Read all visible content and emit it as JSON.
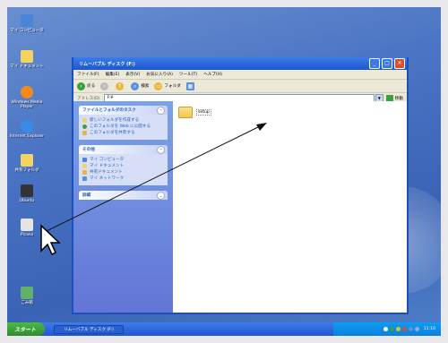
{
  "desktop_icons": [
    {
      "label": "マイ コンピュータ",
      "color": "#4a86d8"
    },
    {
      "label": "マイ ドキュメント",
      "color": "#f3d363"
    },
    {
      "label": "Windows Media Player",
      "color": "#f28a1d"
    },
    {
      "label": "Internet Explorer",
      "color": "#3c8ae8"
    },
    {
      "label": "共有フォルダ",
      "color": "#f3d363"
    },
    {
      "label": "Ubuntu",
      "color": "#333333"
    },
    {
      "label": "Picasa",
      "color": "#e5e5e5"
    },
    {
      "label": "ごみ箱",
      "color": "#5fb06a"
    }
  ],
  "window": {
    "title": "リムーバブル ディスク (F:)",
    "menu": [
      "ファイル(F)",
      "編集(E)",
      "表示(V)",
      "お気に入り(A)",
      "ツール(T)",
      "ヘルプ(H)"
    ],
    "toolbar": {
      "back": "戻る",
      "search": "検索",
      "folders": "フォルダ"
    },
    "address": {
      "label": "アドレス(D)",
      "value": "F:¥",
      "go": "移動"
    },
    "panels": [
      {
        "title": "ファイルとフォルダのタスク",
        "items": [
          "新しいフォルダを作成する",
          "このフォルダを Web に公開する",
          "このフォルダを共有する"
        ]
      },
      {
        "title": "その他",
        "items": [
          "マイ コンピュータ",
          "マイ ドキュメント",
          "共有ドキュメント",
          "マイ ネットワーク"
        ]
      },
      {
        "title": "詳細",
        "items": []
      }
    ],
    "files": [
      {
        "name": "setup"
      }
    ]
  },
  "taskbar": {
    "start": "スタート",
    "task": "リムーバブル ディスク (F:)",
    "clock": "11:10"
  },
  "brand": {
    "xp": "xp"
  }
}
